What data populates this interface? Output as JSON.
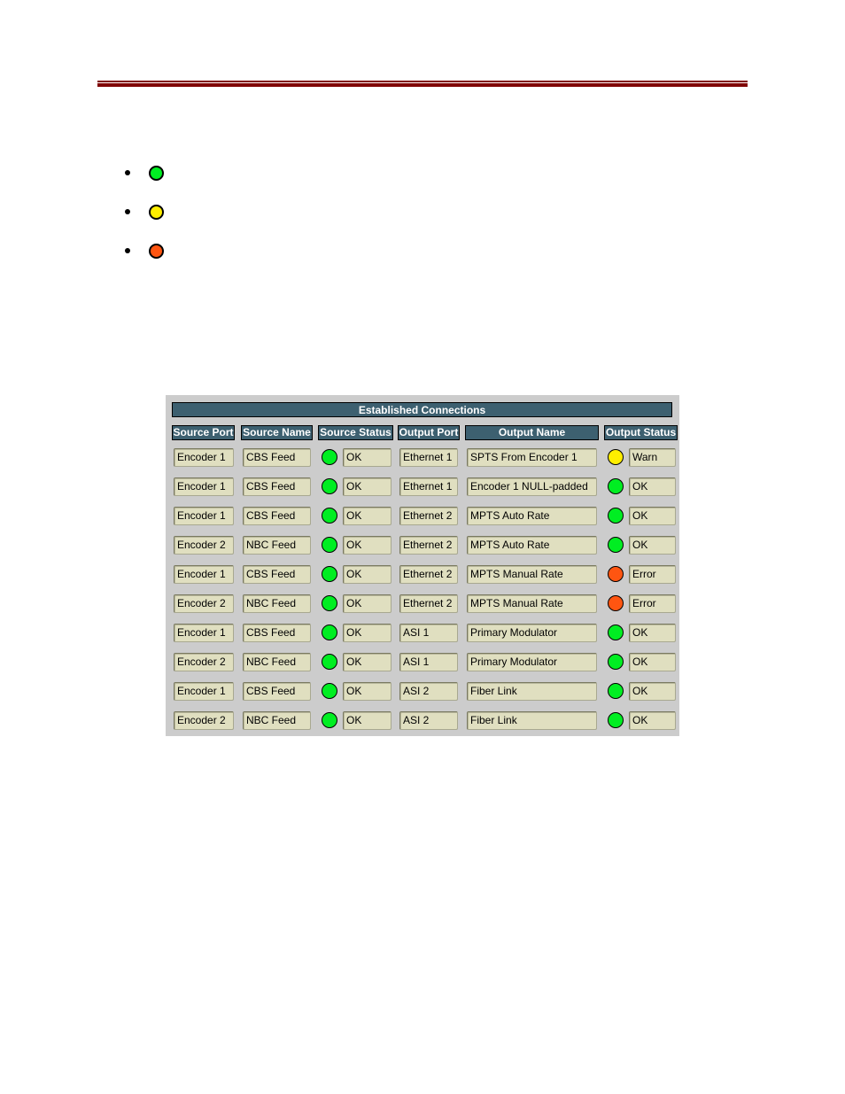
{
  "colors": {
    "rule": "#800000",
    "header_bg": "#3d6070",
    "panel_bg": "#cccccc",
    "field_bg": "#e0dfc0",
    "status_ok": "#00ee22",
    "status_warn": "#ffee00",
    "status_error": "#ff5511"
  },
  "legend": {
    "items": [
      {
        "status": "ok",
        "color": "#00ee22"
      },
      {
        "status": "warn",
        "color": "#ffee00"
      },
      {
        "status": "error",
        "color": "#ff5511"
      }
    ]
  },
  "panel": {
    "title": "Established Connections",
    "headers": {
      "source_port": "Source Port",
      "source_name": "Source Name",
      "source_status": "Source Status",
      "output_port": "Output Port",
      "output_name": "Output Name",
      "output_status": "Output Status"
    },
    "rows": [
      {
        "source_port": "Encoder 1",
        "source_name": "CBS Feed",
        "source_status": "OK",
        "source_lamp": "ok",
        "output_port": "Ethernet 1",
        "output_name": "SPTS From Encoder 1",
        "output_status": "Warn",
        "output_lamp": "warn"
      },
      {
        "source_port": "Encoder 1",
        "source_name": "CBS Feed",
        "source_status": "OK",
        "source_lamp": "ok",
        "output_port": "Ethernet 1",
        "output_name": "Encoder 1 NULL-padded",
        "output_status": "OK",
        "output_lamp": "ok"
      },
      {
        "source_port": "Encoder 1",
        "source_name": "CBS Feed",
        "source_status": "OK",
        "source_lamp": "ok",
        "output_port": "Ethernet 2",
        "output_name": "MPTS Auto Rate",
        "output_status": "OK",
        "output_lamp": "ok"
      },
      {
        "source_port": "Encoder 2",
        "source_name": "NBC Feed",
        "source_status": "OK",
        "source_lamp": "ok",
        "output_port": "Ethernet 2",
        "output_name": "MPTS Auto Rate",
        "output_status": "OK",
        "output_lamp": "ok"
      },
      {
        "source_port": "Encoder 1",
        "source_name": "CBS Feed",
        "source_status": "OK",
        "source_lamp": "ok",
        "output_port": "Ethernet 2",
        "output_name": "MPTS Manual Rate",
        "output_status": "Error",
        "output_lamp": "error"
      },
      {
        "source_port": "Encoder 2",
        "source_name": "NBC Feed",
        "source_status": "OK",
        "source_lamp": "ok",
        "output_port": "Ethernet 2",
        "output_name": "MPTS Manual Rate",
        "output_status": "Error",
        "output_lamp": "error"
      },
      {
        "source_port": "Encoder 1",
        "source_name": "CBS Feed",
        "source_status": "OK",
        "source_lamp": "ok",
        "output_port": "ASI 1",
        "output_name": "Primary Modulator",
        "output_status": "OK",
        "output_lamp": "ok"
      },
      {
        "source_port": "Encoder 2",
        "source_name": "NBC Feed",
        "source_status": "OK",
        "source_lamp": "ok",
        "output_port": "ASI 1",
        "output_name": "Primary Modulator",
        "output_status": "OK",
        "output_lamp": "ok"
      },
      {
        "source_port": "Encoder 1",
        "source_name": "CBS Feed",
        "source_status": "OK",
        "source_lamp": "ok",
        "output_port": "ASI 2",
        "output_name": "Fiber Link",
        "output_status": "OK",
        "output_lamp": "ok"
      },
      {
        "source_port": "Encoder 2",
        "source_name": "NBC Feed",
        "source_status": "OK",
        "source_lamp": "ok",
        "output_port": "ASI 2",
        "output_name": "Fiber Link",
        "output_status": "OK",
        "output_lamp": "ok"
      }
    ]
  }
}
